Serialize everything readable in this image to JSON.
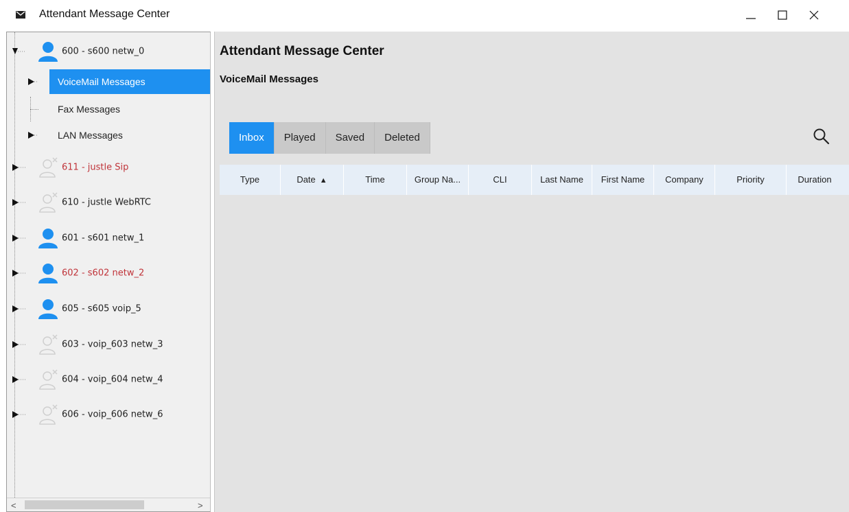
{
  "window": {
    "title": "Attendant Message Center",
    "icon": "envelope-icon",
    "controls": {
      "minimize": "minimize-icon",
      "maximize": "maximize-icon",
      "close": "close-icon"
    }
  },
  "colors": {
    "accent": "#1e90f0",
    "offline_name": "#c0343a",
    "online_avatar": "#1e90f0",
    "offline_avatar": "#cfcfcf"
  },
  "tree": {
    "root": {
      "label": "600 - s600 netw_0",
      "expanded": true,
      "avatar": "user-online-icon",
      "children": [
        {
          "label": "VoiceMail Messages",
          "selected": true,
          "has_children": true
        },
        {
          "label": "Fax Messages",
          "selected": false,
          "has_children": false
        },
        {
          "label": "LAN Messages",
          "selected": false,
          "has_children": true
        }
      ]
    },
    "items": [
      {
        "label": "611 - justle Sip",
        "status": "offline",
        "color": "red",
        "avatar": "user-offline-icon"
      },
      {
        "label": "610 - justle WebRTC",
        "status": "offline",
        "color": "dark",
        "avatar": "user-offline-icon"
      },
      {
        "label": "601 - s601 netw_1",
        "status": "online",
        "color": "dark",
        "avatar": "user-online-icon"
      },
      {
        "label": "602 - s602 netw_2",
        "status": "online",
        "color": "red",
        "avatar": "user-online-icon"
      },
      {
        "label": "605 - s605 voip_5",
        "status": "online",
        "color": "dark",
        "avatar": "user-online-icon"
      },
      {
        "label": "603 - voip_603 netw_3",
        "status": "offline",
        "color": "dark",
        "avatar": "user-offline-icon"
      },
      {
        "label": "604 - voip_604 netw_4",
        "status": "offline",
        "color": "dark",
        "avatar": "user-offline-icon"
      },
      {
        "label": "606 - voip_606 netw_6",
        "status": "offline",
        "color": "dark",
        "avatar": "user-offline-icon"
      }
    ],
    "scroll_left": "<",
    "scroll_right": ">"
  },
  "main": {
    "title": "Attendant Message Center",
    "subtitle": "VoiceMail Messages",
    "tabs": [
      {
        "label": "Inbox",
        "active": true
      },
      {
        "label": "Played",
        "active": false
      },
      {
        "label": "Saved",
        "active": false
      },
      {
        "label": "Deleted",
        "active": false
      }
    ],
    "search_icon": "search-icon",
    "columns": [
      {
        "label": "Type"
      },
      {
        "label": "Date",
        "sort": "▲"
      },
      {
        "label": "Time"
      },
      {
        "label": "Group Na..."
      },
      {
        "label": "CLI"
      },
      {
        "label": "Last Name"
      },
      {
        "label": "First Name"
      },
      {
        "label": "Company"
      },
      {
        "label": "Priority"
      },
      {
        "label": "Duration"
      }
    ],
    "rows": []
  }
}
